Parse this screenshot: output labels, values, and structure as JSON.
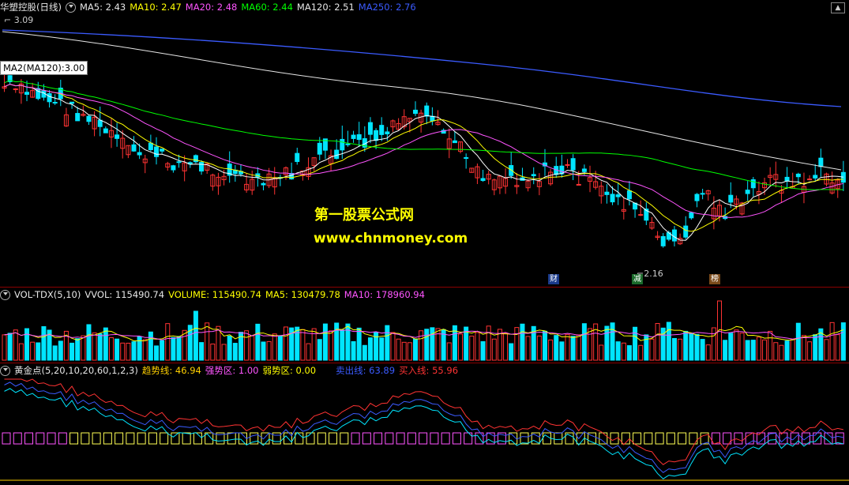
{
  "price_header": {
    "stock_name": "华塑控股(日线)",
    "ma5": "MA5: 2.43",
    "ma10": "MA10: 2.47",
    "ma20": "MA20: 2.48",
    "ma60": "MA60: 2.44",
    "ma120": "MA120: 2.51",
    "ma250": "MA250: 2.76"
  },
  "price_panel": {
    "high_label": "3.09",
    "low_label": "2.16",
    "ma_box": "MA2(MA120):3.00",
    "watermark_cn": "第一股票公式网",
    "watermark_url": "www.chnmoney.com",
    "tags": [
      "财",
      "减",
      "榜"
    ]
  },
  "vol_header": {
    "name": "VOL-TDX(5,10)",
    "vvol": "VVOL: 115490.74",
    "volume": "VOLUME: 115490.74",
    "ma5": "MA5: 130479.78",
    "ma10": "MA10: 178960.94"
  },
  "gold_header": {
    "name": "黄金点(5,20,10,20,60,1,2,3)",
    "trend": "趋势线: 46.94",
    "strong": "强势区: 1.00",
    "weak": "弱势区: 0.00",
    "sell": "卖出线: 63.89",
    "buy": "买入线: 55.96"
  },
  "colors": {
    "up": "#ff3333",
    "down": "#00e5ff",
    "ma5": "#ffffff",
    "ma10": "#ffff00",
    "ma20": "#ff55ff",
    "ma60": "#00ff00",
    "ma120": "#e6e6e6",
    "ma250": "#3b5bff"
  }
}
